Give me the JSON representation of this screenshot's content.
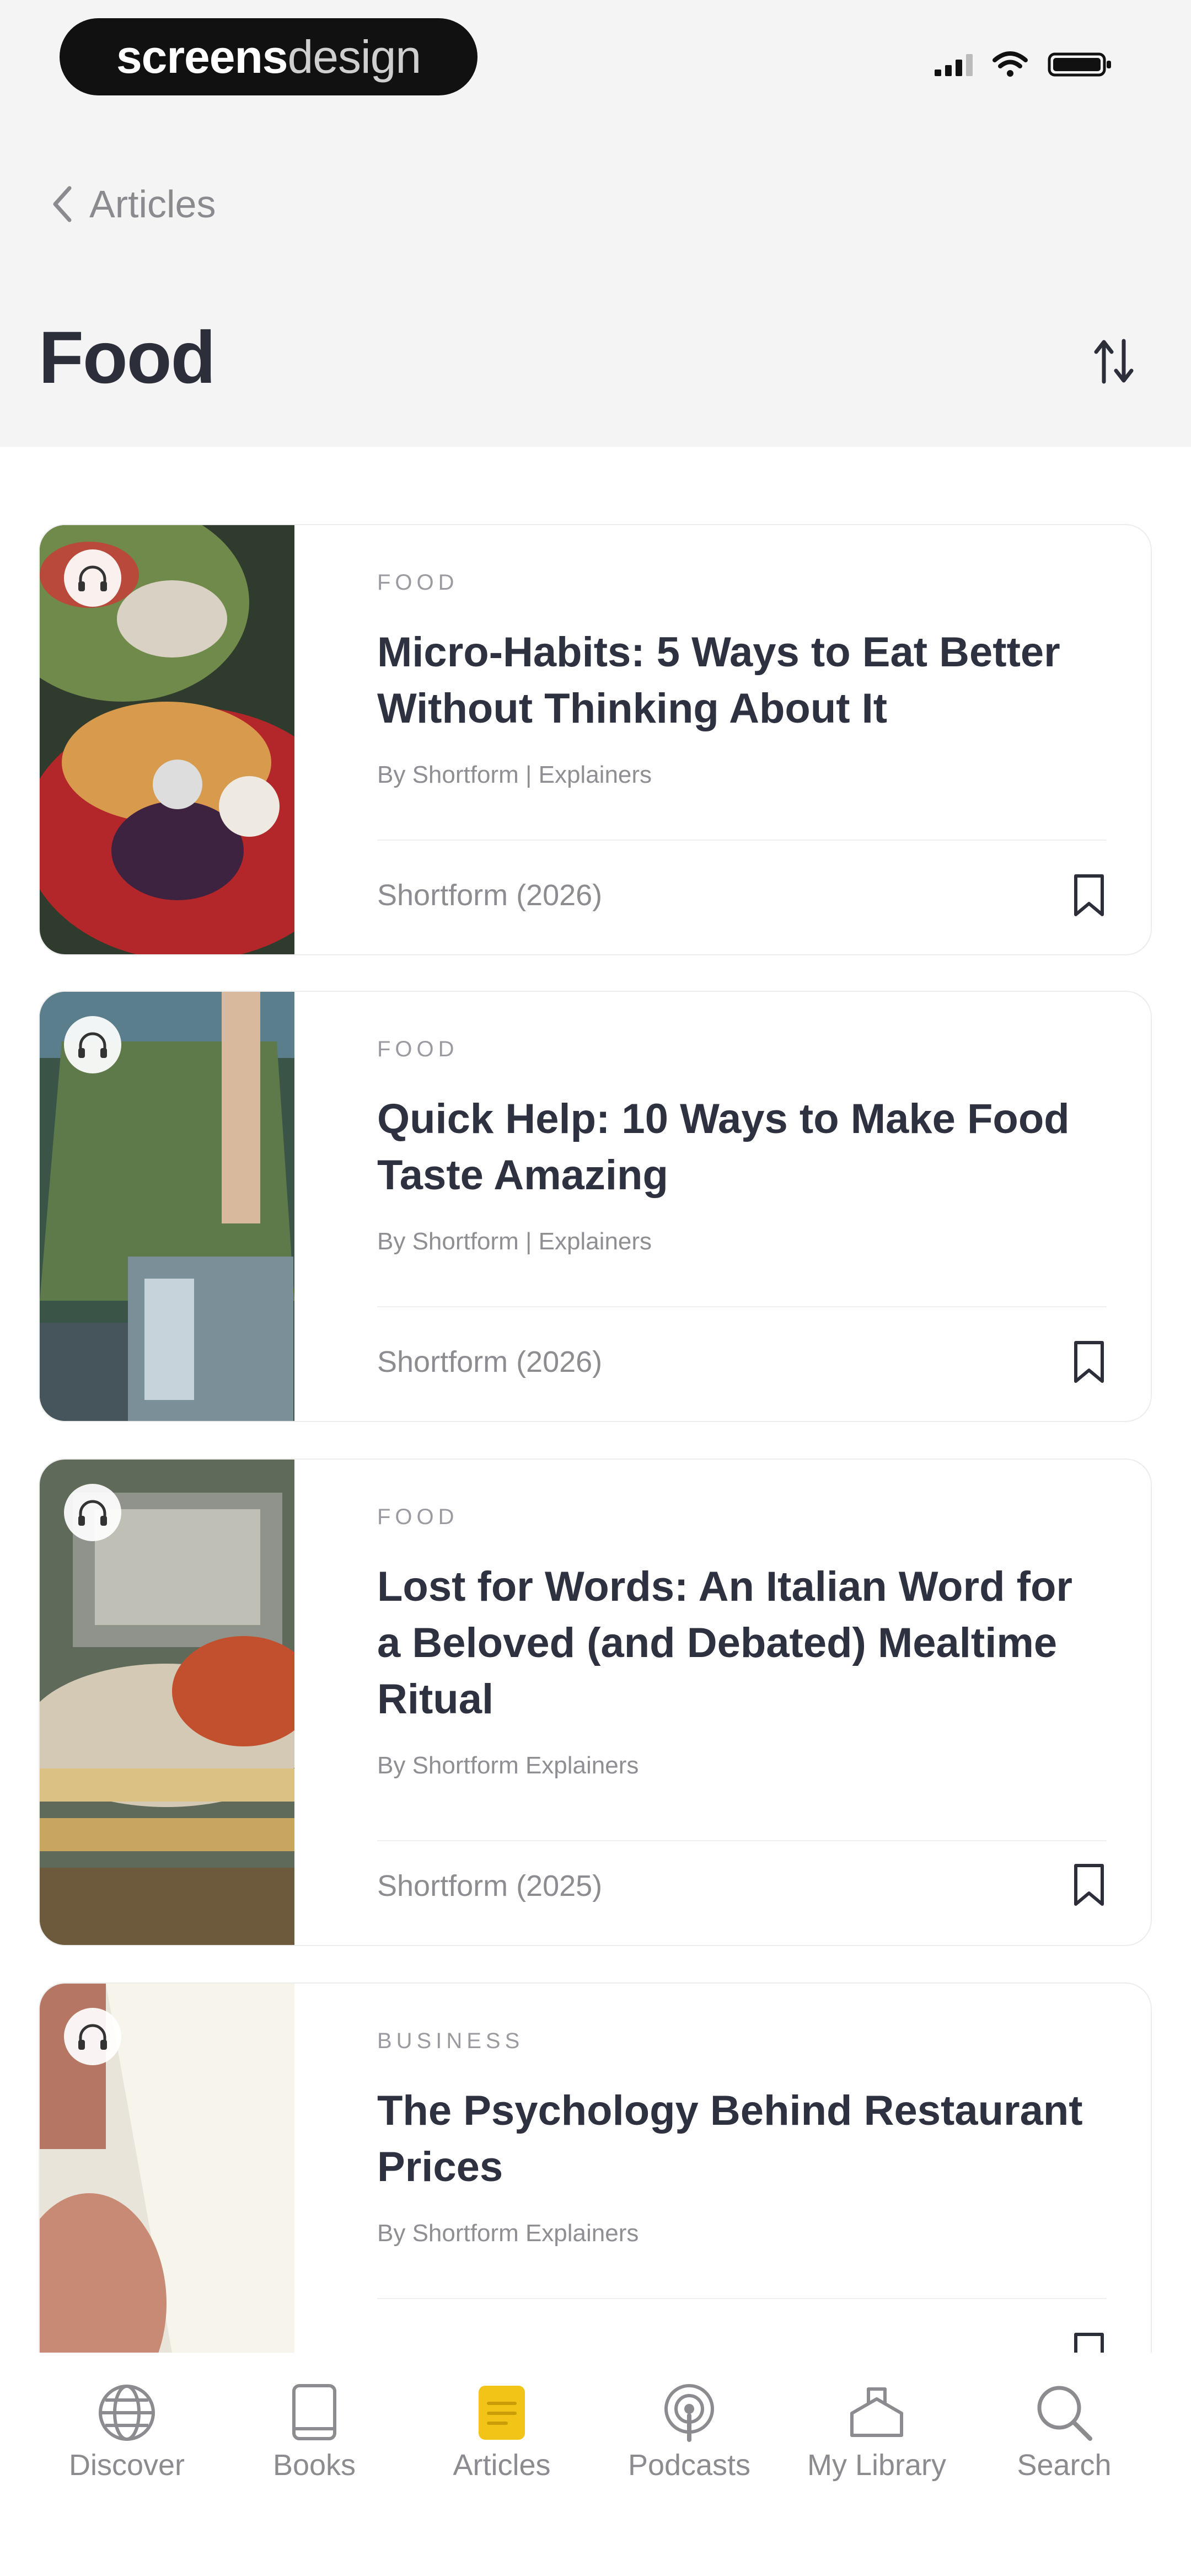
{
  "watermark": {
    "part1": "screens",
    "part2": "design"
  },
  "nav": {
    "back_label": "Articles"
  },
  "page": {
    "title": "Food"
  },
  "articles": [
    {
      "category": "FOOD",
      "title": "Micro-Habits: 5 Ways to Eat Better Without Thinking About It",
      "author": "By Shortform | Explainers",
      "source": "Shortform (2026)"
    },
    {
      "category": "FOOD",
      "title": "Quick Help: 10 Ways to Make Food Taste Amazing",
      "author": "By Shortform | Explainers",
      "source": "Shortform (2026)"
    },
    {
      "category": "FOOD",
      "title": "Lost for Words: An Italian Word for a Beloved (and Debated) Mealtime Ritual",
      "author": "By Shortform Explainers",
      "source": "Shortform (2025)"
    },
    {
      "category": "BUSINESS",
      "title": "The Psychology Behind Restaurant Prices",
      "author": "By Shortform Explainers",
      "source": ""
    }
  ],
  "tabs": [
    {
      "label": "Discover",
      "icon": "globe-icon"
    },
    {
      "label": "Books",
      "icon": "book-icon"
    },
    {
      "label": "Articles",
      "icon": "article-icon"
    },
    {
      "label": "Podcasts",
      "icon": "podcast-icon"
    },
    {
      "label": "My Library",
      "icon": "library-icon"
    },
    {
      "label": "Search",
      "icon": "search-icon"
    }
  ],
  "colors": {
    "accent": "#f2c417",
    "title": "#2c2e3a",
    "muted": "#8c8c91",
    "header_bg": "#f4f4f4"
  }
}
